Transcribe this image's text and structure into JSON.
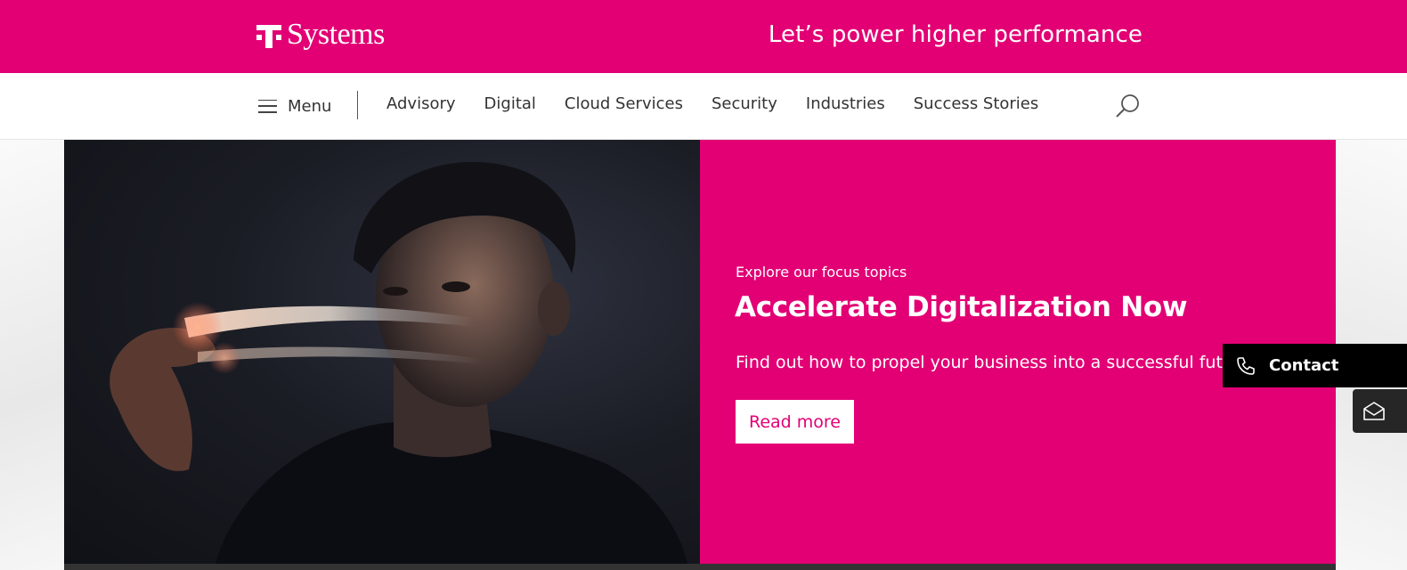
{
  "header": {
    "logo_text": "Systems",
    "tagline": "Let’s power higher performance",
    "brand_color": "#e20074"
  },
  "nav": {
    "menu_label": "Menu",
    "items": [
      {
        "label": "Advisory"
      },
      {
        "label": "Digital"
      },
      {
        "label": "Cloud Services"
      },
      {
        "label": "Security"
      },
      {
        "label": "Industries"
      },
      {
        "label": "Success Stories"
      }
    ],
    "search_icon": "search-icon"
  },
  "hero": {
    "eyebrow": "Explore our focus topics",
    "headline": "Accelerate Digitalization Now",
    "body": "Find out how to propel your business into a successful futu",
    "cta_label": "Read more"
  },
  "floating": {
    "contact_label": "Contact",
    "contact_icon": "phone-icon",
    "mail_icon": "mail-icon"
  }
}
